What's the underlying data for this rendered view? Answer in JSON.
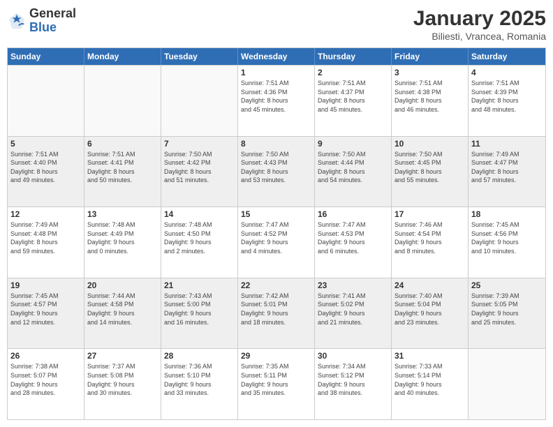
{
  "logo": {
    "general": "General",
    "blue": "Blue"
  },
  "title": "January 2025",
  "subtitle": "Biliesti, Vrancea, Romania",
  "header_days": [
    "Sunday",
    "Monday",
    "Tuesday",
    "Wednesday",
    "Thursday",
    "Friday",
    "Saturday"
  ],
  "weeks": [
    [
      {
        "day": "",
        "info": ""
      },
      {
        "day": "",
        "info": ""
      },
      {
        "day": "",
        "info": ""
      },
      {
        "day": "1",
        "info": "Sunrise: 7:51 AM\nSunset: 4:36 PM\nDaylight: 8 hours\nand 45 minutes."
      },
      {
        "day": "2",
        "info": "Sunrise: 7:51 AM\nSunset: 4:37 PM\nDaylight: 8 hours\nand 45 minutes."
      },
      {
        "day": "3",
        "info": "Sunrise: 7:51 AM\nSunset: 4:38 PM\nDaylight: 8 hours\nand 46 minutes."
      },
      {
        "day": "4",
        "info": "Sunrise: 7:51 AM\nSunset: 4:39 PM\nDaylight: 8 hours\nand 48 minutes."
      }
    ],
    [
      {
        "day": "5",
        "info": "Sunrise: 7:51 AM\nSunset: 4:40 PM\nDaylight: 8 hours\nand 49 minutes."
      },
      {
        "day": "6",
        "info": "Sunrise: 7:51 AM\nSunset: 4:41 PM\nDaylight: 8 hours\nand 50 minutes."
      },
      {
        "day": "7",
        "info": "Sunrise: 7:50 AM\nSunset: 4:42 PM\nDaylight: 8 hours\nand 51 minutes."
      },
      {
        "day": "8",
        "info": "Sunrise: 7:50 AM\nSunset: 4:43 PM\nDaylight: 8 hours\nand 53 minutes."
      },
      {
        "day": "9",
        "info": "Sunrise: 7:50 AM\nSunset: 4:44 PM\nDaylight: 8 hours\nand 54 minutes."
      },
      {
        "day": "10",
        "info": "Sunrise: 7:50 AM\nSunset: 4:45 PM\nDaylight: 8 hours\nand 55 minutes."
      },
      {
        "day": "11",
        "info": "Sunrise: 7:49 AM\nSunset: 4:47 PM\nDaylight: 8 hours\nand 57 minutes."
      }
    ],
    [
      {
        "day": "12",
        "info": "Sunrise: 7:49 AM\nSunset: 4:48 PM\nDaylight: 8 hours\nand 59 minutes."
      },
      {
        "day": "13",
        "info": "Sunrise: 7:48 AM\nSunset: 4:49 PM\nDaylight: 9 hours\nand 0 minutes."
      },
      {
        "day": "14",
        "info": "Sunrise: 7:48 AM\nSunset: 4:50 PM\nDaylight: 9 hours\nand 2 minutes."
      },
      {
        "day": "15",
        "info": "Sunrise: 7:47 AM\nSunset: 4:52 PM\nDaylight: 9 hours\nand 4 minutes."
      },
      {
        "day": "16",
        "info": "Sunrise: 7:47 AM\nSunset: 4:53 PM\nDaylight: 9 hours\nand 6 minutes."
      },
      {
        "day": "17",
        "info": "Sunrise: 7:46 AM\nSunset: 4:54 PM\nDaylight: 9 hours\nand 8 minutes."
      },
      {
        "day": "18",
        "info": "Sunrise: 7:45 AM\nSunset: 4:56 PM\nDaylight: 9 hours\nand 10 minutes."
      }
    ],
    [
      {
        "day": "19",
        "info": "Sunrise: 7:45 AM\nSunset: 4:57 PM\nDaylight: 9 hours\nand 12 minutes."
      },
      {
        "day": "20",
        "info": "Sunrise: 7:44 AM\nSunset: 4:58 PM\nDaylight: 9 hours\nand 14 minutes."
      },
      {
        "day": "21",
        "info": "Sunrise: 7:43 AM\nSunset: 5:00 PM\nDaylight: 9 hours\nand 16 minutes."
      },
      {
        "day": "22",
        "info": "Sunrise: 7:42 AM\nSunset: 5:01 PM\nDaylight: 9 hours\nand 18 minutes."
      },
      {
        "day": "23",
        "info": "Sunrise: 7:41 AM\nSunset: 5:02 PM\nDaylight: 9 hours\nand 21 minutes."
      },
      {
        "day": "24",
        "info": "Sunrise: 7:40 AM\nSunset: 5:04 PM\nDaylight: 9 hours\nand 23 minutes."
      },
      {
        "day": "25",
        "info": "Sunrise: 7:39 AM\nSunset: 5:05 PM\nDaylight: 9 hours\nand 25 minutes."
      }
    ],
    [
      {
        "day": "26",
        "info": "Sunrise: 7:38 AM\nSunset: 5:07 PM\nDaylight: 9 hours\nand 28 minutes."
      },
      {
        "day": "27",
        "info": "Sunrise: 7:37 AM\nSunset: 5:08 PM\nDaylight: 9 hours\nand 30 minutes."
      },
      {
        "day": "28",
        "info": "Sunrise: 7:36 AM\nSunset: 5:10 PM\nDaylight: 9 hours\nand 33 minutes."
      },
      {
        "day": "29",
        "info": "Sunrise: 7:35 AM\nSunset: 5:11 PM\nDaylight: 9 hours\nand 35 minutes."
      },
      {
        "day": "30",
        "info": "Sunrise: 7:34 AM\nSunset: 5:12 PM\nDaylight: 9 hours\nand 38 minutes."
      },
      {
        "day": "31",
        "info": "Sunrise: 7:33 AM\nSunset: 5:14 PM\nDaylight: 9 hours\nand 40 minutes."
      },
      {
        "day": "",
        "info": ""
      }
    ]
  ]
}
